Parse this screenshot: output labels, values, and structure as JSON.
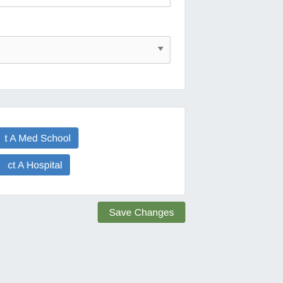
{
  "form": {
    "text_input": {
      "value": ""
    },
    "select": {
      "selected": ""
    }
  },
  "associations": {
    "med_school_button": "t A Med School",
    "hospital_button": "ct A Hospital"
  },
  "actions": {
    "save_label": "Save Changes"
  },
  "colors": {
    "background": "#e9edf0",
    "primary_blue": "#3f7fc1",
    "save_green": "#628c4f"
  }
}
